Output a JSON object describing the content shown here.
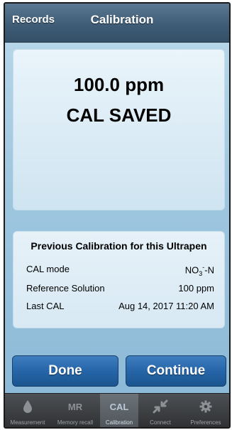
{
  "nav": {
    "back_label": "Records",
    "title": "Calibration"
  },
  "main": {
    "reading": "100.0 ppm",
    "status": "CAL SAVED"
  },
  "info": {
    "title": "Previous Calibration for this Ultrapen",
    "rows": [
      {
        "label": "CAL mode",
        "value_base": "NO",
        "value_sub": "3",
        "value_sup": "-",
        "value_suffix": "-N"
      },
      {
        "label": "Reference Solution",
        "value": "100 ppm"
      },
      {
        "label": "Last CAL",
        "value": "Aug 14, 2017 11:20 AM"
      }
    ]
  },
  "buttons": {
    "done": "Done",
    "continue": "Continue"
  },
  "tabs": [
    {
      "label": "Measurement",
      "icon": "drop-icon"
    },
    {
      "label": "Memory recall",
      "icon_text": "MR"
    },
    {
      "label": "Calibration",
      "icon_text": "CAL",
      "active": true
    },
    {
      "label": "Connect",
      "icon": "connect-arrows-icon"
    },
    {
      "label": "Preferences",
      "icon": "gear-icon"
    }
  ],
  "colors": {
    "accent_button": "#2565a8",
    "navbar": "#3f5d77",
    "background": "#9ec6df",
    "tabbar": "#3a3c3f"
  }
}
